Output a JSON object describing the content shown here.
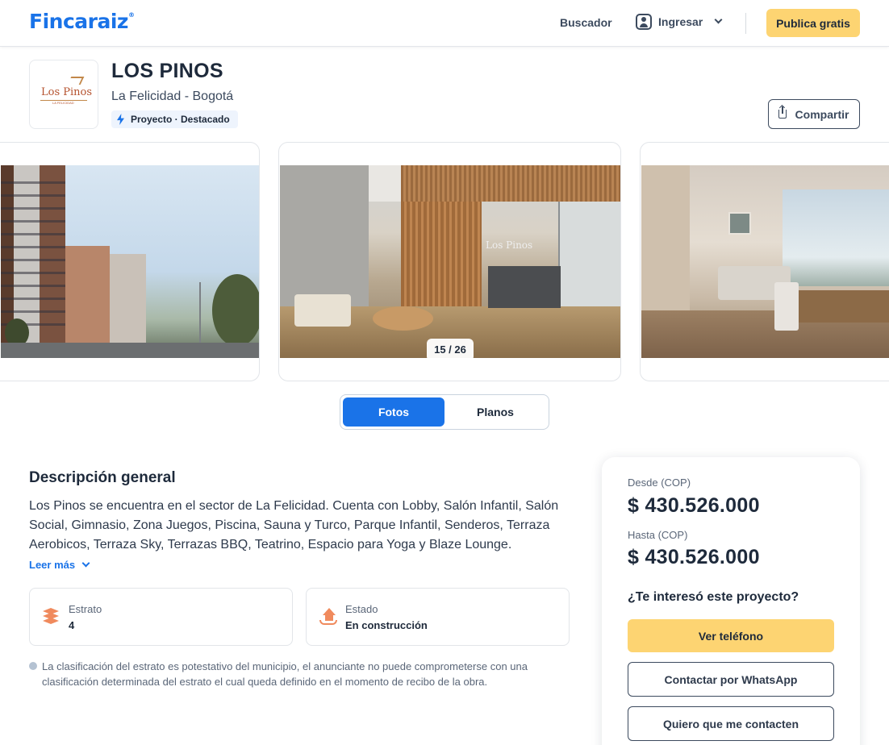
{
  "header": {
    "logo": "Fincaraiz",
    "logo_mark": "®",
    "nav": {
      "buscador": "Buscador",
      "ingresar": "Ingresar"
    },
    "publish_label": "Publica gratis"
  },
  "project": {
    "logo_text": "Los Pinos",
    "logo_subtext": "LA FELICIDAD",
    "title": "LOS PINOS",
    "location": "La Felicidad - Bogotá",
    "badge": "Proyecto · Destacado",
    "share_label": "Compartir"
  },
  "gallery": {
    "counter": "15 / 26",
    "mid_photo_sign": "Los Pinos",
    "tabs": [
      {
        "label": "Fotos",
        "active": true
      },
      {
        "label": "Planos",
        "active": false
      }
    ]
  },
  "description": {
    "title": "Descripción general",
    "text": "Los Pinos se encuentra en el sector de La Felicidad. Cuenta con Lobby, Salón Infantil, Salón Social, Gimnasio, Zona Juegos, Piscina, Sauna y Turco, Parque Infantil, Senderos, Terraza Aerobicos, Terraza Sky, Terrazas BBQ, Teatrino, Espacio para Yoga y Blaze Lounge.",
    "read_more": "Leer más",
    "details": [
      {
        "label": "Estrato",
        "value": "4",
        "icon": "layers-icon"
      },
      {
        "label": "Estado",
        "value": "En construcción",
        "icon": "house-hand-icon"
      }
    ],
    "note": "La clasificación del estrato es potestativo del municipio, el anunciante no puede comprometerse con una clasificación determinada del estrato el cual queda definido en el momento de recibo de la obra."
  },
  "pricing": {
    "from_label": "Desde (COP)",
    "from_value": "$ 430.526.000",
    "to_label": "Hasta (COP)",
    "to_value": "$ 430.526.000",
    "question": "¿Te interesó este proyecto?",
    "buttons": {
      "phone": "Ver teléfono",
      "whatsapp": "Contactar por WhatsApp",
      "contact_me": "Quiero que me contacten"
    }
  },
  "colors": {
    "brand_blue": "#1a73e8",
    "cta_yellow": "#fdd472",
    "icon_orange": "#f08a5d"
  }
}
